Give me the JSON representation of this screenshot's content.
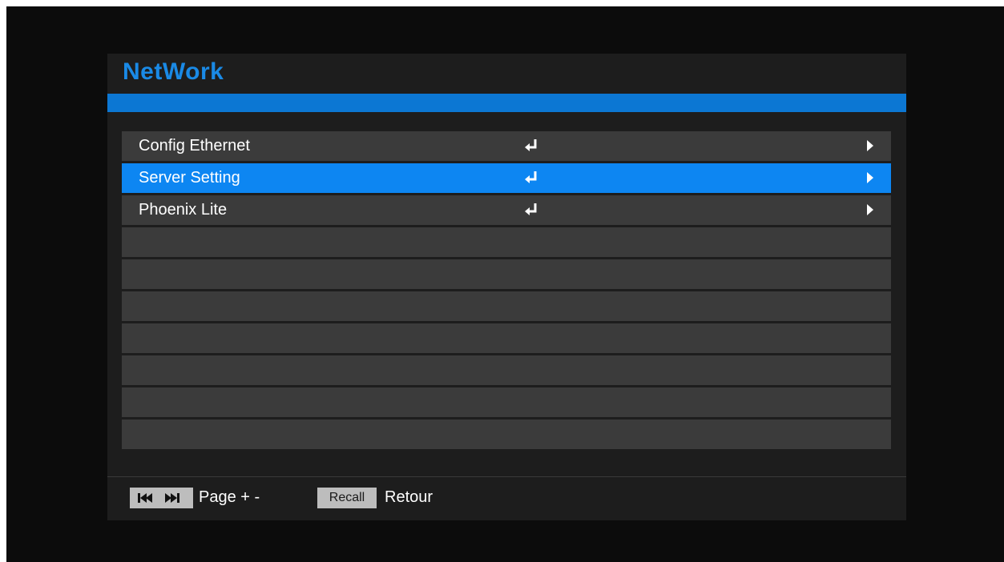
{
  "title": "NetWork",
  "menu": {
    "items": [
      {
        "label": "Config Ethernet",
        "selected": false
      },
      {
        "label": "Server Setting",
        "selected": true
      },
      {
        "label": "Phoenix Lite",
        "selected": false
      },
      {
        "label": ""
      },
      {
        "label": ""
      },
      {
        "label": ""
      },
      {
        "label": ""
      },
      {
        "label": ""
      },
      {
        "label": ""
      },
      {
        "label": ""
      }
    ]
  },
  "footer": {
    "page_key_icons": [
      "prev-track-icon",
      "next-track-icon"
    ],
    "page_label": "Page + -",
    "recall_key": "Recall",
    "recall_label": "Retour"
  },
  "colors": {
    "accent": "#0d86f2",
    "title": "#1a8ae6",
    "row": "#3b3b3b",
    "panel": "#1d1d1d"
  }
}
